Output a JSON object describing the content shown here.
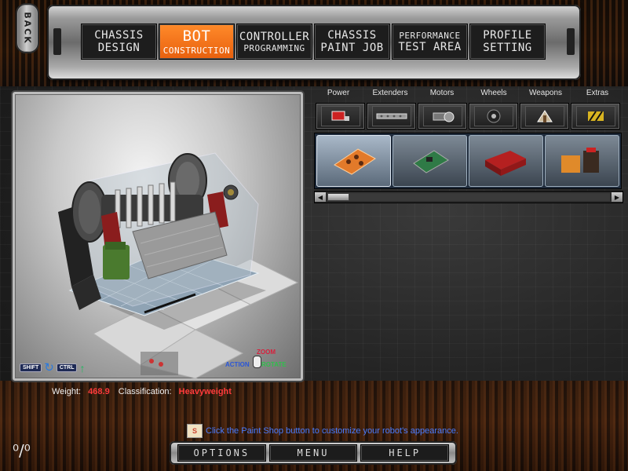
{
  "back": {
    "label": "BACK"
  },
  "nav": [
    {
      "line1": "CHASSIS",
      "line2": "DESIGN",
      "active": false
    },
    {
      "line1": "BOT",
      "line2": "CONSTRUCTION",
      "active": true
    },
    {
      "line1": "CONTROLLER",
      "line2": "PROGRAMMING",
      "active": false
    },
    {
      "line1": "CHASSIS",
      "line2": "PAINT JOB",
      "active": false
    },
    {
      "line1": "PERFORMANCE",
      "line2": "TEST AREA",
      "active": false
    },
    {
      "line1": "PROFILE",
      "line2": "SETTING",
      "active": false
    }
  ],
  "viewport": {
    "controls": {
      "shift_key": "SHIFT",
      "ctrl_key": "CTRL",
      "rotate_icon": "rotate-icon",
      "move_icon": "move-up-icon"
    },
    "mouse_legend": {
      "zoom": "ZOOM",
      "action": "ACTION",
      "rotate": "ROTATE"
    }
  },
  "status": {
    "weight_label": "Weight:",
    "weight_value": "468.9",
    "class_label": "Classification:",
    "class_value": "Heavyweight"
  },
  "parts": {
    "categories": [
      "Power",
      "Extenders",
      "Motors",
      "Wheels",
      "Weapons",
      "Extras"
    ],
    "category_icons": [
      "battery-icon",
      "extender-bar-icon",
      "motor-icon",
      "wheel-icon",
      "weapon-icon",
      "extras-icon"
    ],
    "items": [
      {
        "icon": "orange-battery-pack-icon",
        "selected": true
      },
      {
        "icon": "circuit-board-icon",
        "selected": false
      },
      {
        "icon": "red-battery-box-icon",
        "selected": false
      },
      {
        "icon": "battery-cells-icon",
        "selected": false
      }
    ]
  },
  "hint": {
    "text": "Click the Paint Shop button to customize your robot's appearance."
  },
  "bottom_menu": {
    "options": "OPTIONS",
    "menu": "MENU",
    "help": "HELP"
  },
  "colors": {
    "accent": "#e8600e",
    "hint": "#4a7cff",
    "status_value": "#ff3b3b"
  }
}
